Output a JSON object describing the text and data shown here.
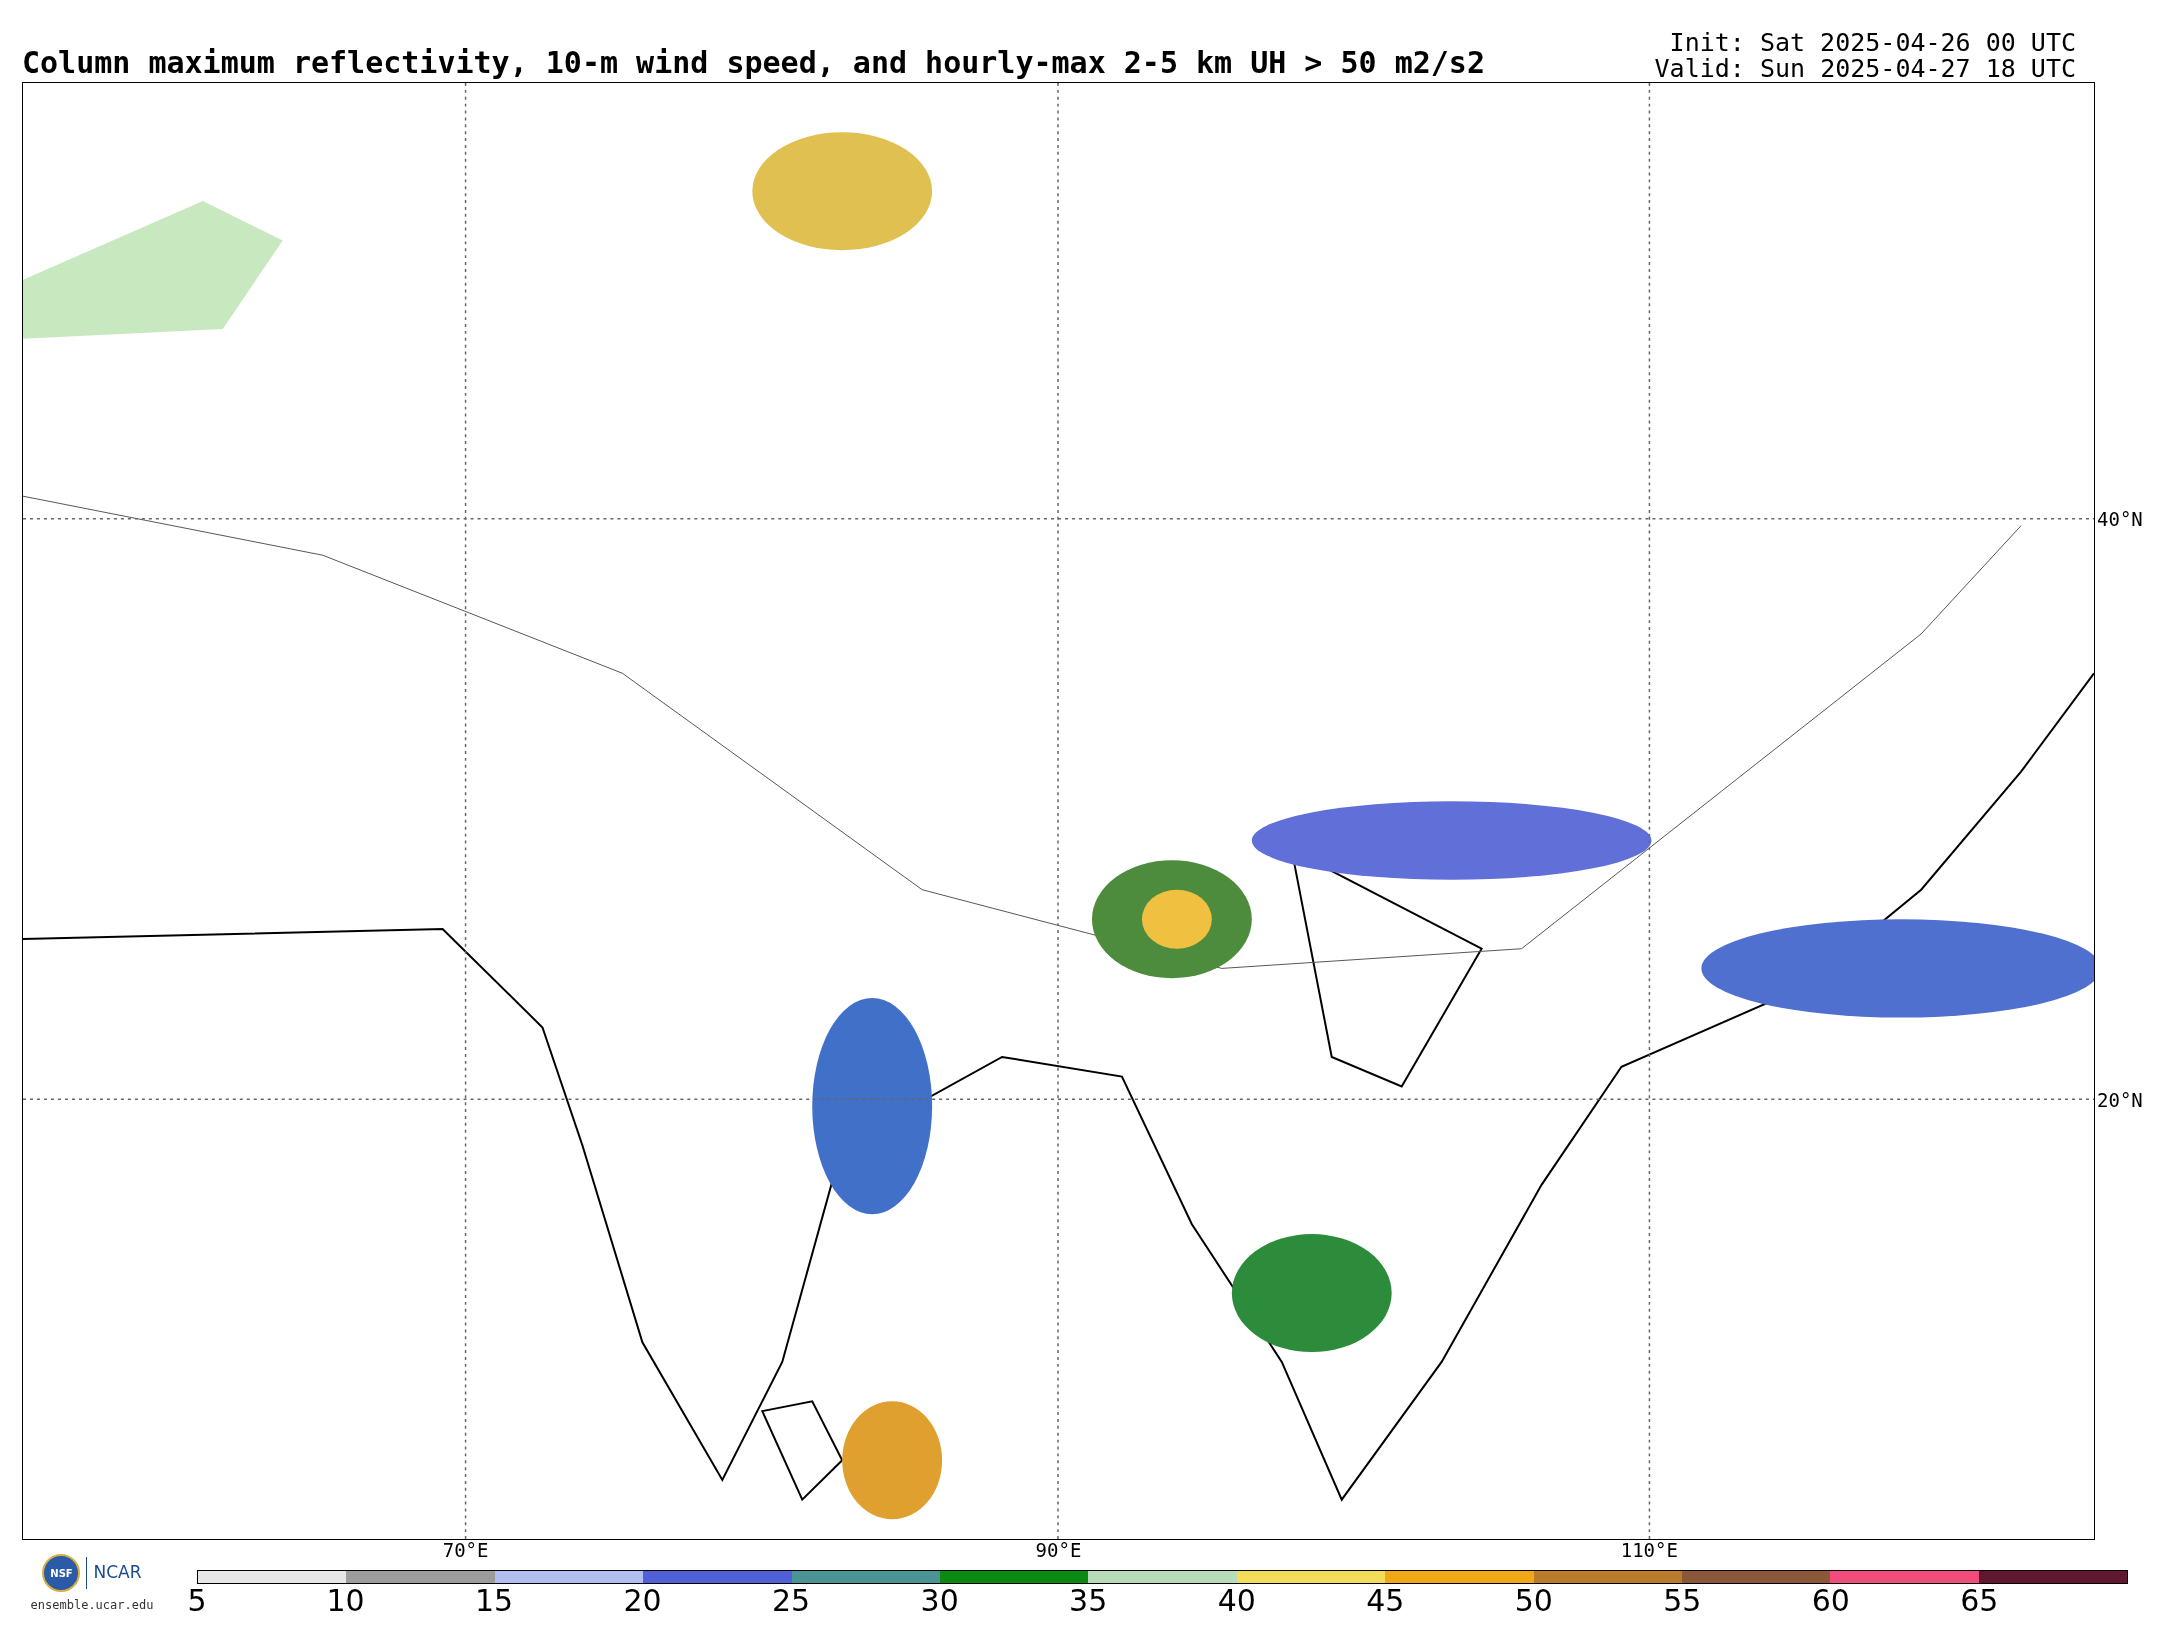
{
  "title": "Column maximum reflectivity, 10-m wind speed, and hourly-max 2-5 km UH > 50 m2/s2",
  "init": "Init: Sat 2025-04-26 00 UTC",
  "valid": "Valid: Sun 2025-04-27 18 UTC",
  "map": {
    "lat_labels": [
      "40°N",
      "20°N"
    ],
    "lon_labels": [
      "70°E",
      "90°E",
      "110°E"
    ]
  },
  "logo": {
    "left": "NSF",
    "right": "NCAR",
    "url": "ensemble.ucar.edu"
  },
  "colorbar": {
    "bins": [
      {
        "color": "#e6e6e6"
      },
      {
        "color": "#9c9c9c"
      },
      {
        "color": "#b3bef0"
      },
      {
        "color": "#5060d8"
      },
      {
        "color": "#4a9496"
      },
      {
        "color": "#0a8a10"
      },
      {
        "color": "#b8dcb8"
      },
      {
        "color": "#f2dc5a"
      },
      {
        "color": "#f0a818"
      },
      {
        "color": "#b87c2c"
      },
      {
        "color": "#8a5838"
      },
      {
        "color": "#f04c7c"
      },
      {
        "color": "#601830"
      }
    ],
    "ticks": [
      "5",
      "10",
      "15",
      "20",
      "25",
      "30",
      "35",
      "40",
      "45",
      "50",
      "55",
      "60",
      "65"
    ]
  }
}
